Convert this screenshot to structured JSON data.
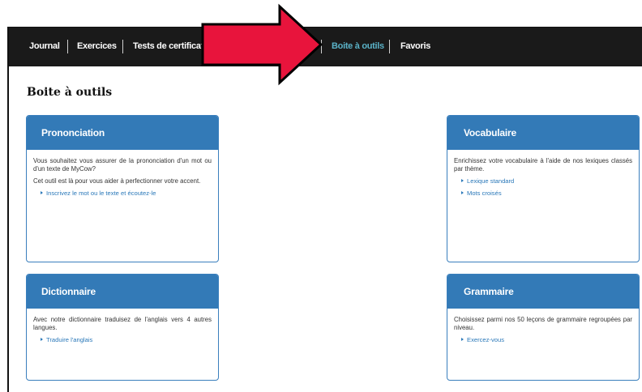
{
  "nav": {
    "items": [
      {
        "label": "Journal",
        "active": false
      },
      {
        "label": "Exercices",
        "active": false
      },
      {
        "label": "Tests de certification",
        "active": false
      },
      {
        "label": "Boite à outils",
        "active": true
      },
      {
        "label": "Favoris",
        "active": false
      }
    ]
  },
  "page": {
    "title": "Boite à outils"
  },
  "cards": {
    "prononciation": {
      "title": "Prononciation",
      "paragraphs": [
        "Vous souhaitez vous assurer de la prononciation d'un mot ou d'un texte de MyCow?",
        "Cet outil est là pour vous aider à perfectionner votre accent."
      ],
      "links": [
        "Inscrivez le mot ou le texte et écoutez-le"
      ]
    },
    "vocabulaire": {
      "title": "Vocabulaire",
      "paragraphs": [
        "Enrichissez votre vocabulaire à l'aide de nos lexiques classés par thème."
      ],
      "links": [
        "Lexique standard",
        "Mots croisés"
      ]
    },
    "dictionnaire": {
      "title": "Dictionnaire",
      "paragraphs": [
        "Avec notre dictionnaire traduisez de l'anglais vers 4 autres langues."
      ],
      "links": [
        "Traduire l'anglais"
      ]
    },
    "grammaire": {
      "title": "Grammaire",
      "paragraphs": [
        "Choisissez parmi nos 50 leçons de grammaire regroupées par niveau."
      ],
      "links": [
        "Exercez-vous"
      ]
    }
  },
  "colors": {
    "accent": "#337ab7",
    "nav_active": "#5ab1c6",
    "arrow": "#e8143c"
  },
  "annotation": {
    "icon": "red-arrow-icon"
  }
}
